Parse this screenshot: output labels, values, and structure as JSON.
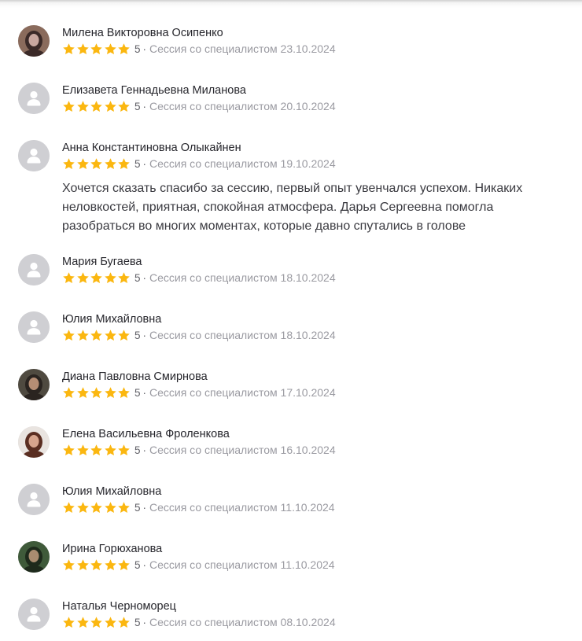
{
  "reviews": [
    {
      "name": "Милена Викторовна Осипенко",
      "rating": "5",
      "separator": "·",
      "session": "Сессия со специалистом 23.10.2024",
      "avatar": "photo",
      "avatar_colors": [
        "#8a6b5c",
        "#c9a8a0",
        "#3b2a28"
      ]
    },
    {
      "name": "Елизавета Геннадьевна Миланова",
      "rating": "5",
      "separator": "·",
      "session": "Сессия со специалистом 20.10.2024",
      "avatar": "placeholder"
    },
    {
      "name": "Анна Константиновна Олыкайнен",
      "rating": "5",
      "separator": "·",
      "session": "Сессия со специалистом 19.10.2024",
      "avatar": "placeholder",
      "text": "Хочется сказать спасибо за сессию, первый опыт увенчался успехом. Никаких\nнеловкостей, приятная, спокойная атмосфера. Дарья Сергеевна помогла\nразобраться во многих моментах, которые давно спутались в голове"
    },
    {
      "name": "Мария Бугаева",
      "rating": "5",
      "separator": "·",
      "session": "Сессия со специалистом 18.10.2024",
      "avatar": "placeholder"
    },
    {
      "name": "Юлия Михайловна",
      "rating": "5",
      "separator": "·",
      "session": "Сессия со специалистом 18.10.2024",
      "avatar": "placeholder"
    },
    {
      "name": "Диана Павловна Смирнова",
      "rating": "5",
      "separator": "·",
      "session": "Сессия со специалистом 17.10.2024",
      "avatar": "photo",
      "avatar_colors": [
        "#4f4a40",
        "#b58d74",
        "#2a2420"
      ]
    },
    {
      "name": "Елена Васильевна Фроленкова",
      "rating": "5",
      "separator": "·",
      "session": "Сессия со специалистом 16.10.2024",
      "avatar": "photo",
      "avatar_colors": [
        "#e9e4e0",
        "#d7a58e",
        "#5a2e22"
      ]
    },
    {
      "name": "Юлия Михайловна",
      "rating": "5",
      "separator": "·",
      "session": "Сессия со специалистом 11.10.2024",
      "avatar": "placeholder"
    },
    {
      "name": "Ирина Горюханова",
      "rating": "5",
      "separator": "·",
      "session": "Сессия со специалистом 11.10.2024",
      "avatar": "photo",
      "avatar_colors": [
        "#3f5a3a",
        "#a98c70",
        "#1e2a1c"
      ]
    },
    {
      "name": "Наталья Черноморец",
      "rating": "5",
      "separator": "·",
      "session": "Сессия со специалистом 08.10.2024",
      "avatar": "placeholder"
    }
  ],
  "colors": {
    "star": "#fbb710",
    "placeholder_bg": "#cfcfd3",
    "placeholder_fg": "#ffffff",
    "name": "#26262c",
    "meta": "#9a9aa1",
    "text": "#3a3a40"
  },
  "icons": {
    "star": "star-icon",
    "placeholder": "user-icon"
  }
}
